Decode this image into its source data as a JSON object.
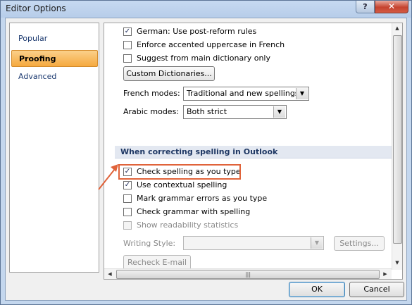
{
  "window": {
    "title": "Editor Options",
    "help_label": "?",
    "close_label": "✕"
  },
  "nav": {
    "items": [
      {
        "label": "Popular",
        "selected": false
      },
      {
        "label": "Proofing",
        "selected": true
      },
      {
        "label": "Advanced",
        "selected": false
      }
    ]
  },
  "options_top": [
    {
      "label": "German: Use post-reform rules",
      "checked": true
    },
    {
      "label": "Enforce accented uppercase in French",
      "checked": false
    },
    {
      "label": "Suggest from main dictionary only",
      "checked": false
    }
  ],
  "custom_dictionaries_label": "Custom Dictionaries...",
  "french_modes": {
    "label": "French modes:",
    "value": "Traditional and new spellings"
  },
  "arabic_modes": {
    "label": "Arabic modes:",
    "value": "Both strict"
  },
  "section_outlook": {
    "title": "When correcting spelling in Outlook"
  },
  "options_outlook": [
    {
      "label": "Check spelling as you type",
      "checked": true,
      "disabled": false
    },
    {
      "label": "Use contextual spelling",
      "checked": true,
      "disabled": false
    },
    {
      "label": "Mark grammar errors as you type",
      "checked": false,
      "disabled": false
    },
    {
      "label": "Check grammar with spelling",
      "checked": false,
      "disabled": false
    },
    {
      "label": "Show readability statistics",
      "checked": false,
      "disabled": true
    }
  ],
  "writing_style": {
    "label": "Writing Style:",
    "value": ""
  },
  "settings_label": "Settings...",
  "recheck_label": "Recheck E-mail",
  "check_glyph": "✓",
  "footer": {
    "ok_label": "OK",
    "cancel_label": "Cancel"
  },
  "colors": {
    "highlight": "#e0633a",
    "nav_selected": "#f5a93f",
    "section_header_text": "#1f3864"
  }
}
